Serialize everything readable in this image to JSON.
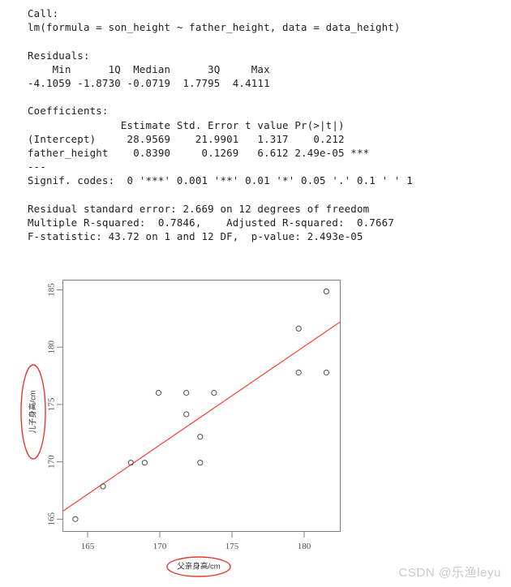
{
  "console": {
    "lines": [
      "Call:",
      "lm(formula = son_height ~ father_height, data = data_height)",
      "",
      "Residuals:",
      "    Min      1Q  Median      3Q     Max ",
      "-4.1059 -1.8730 -0.0719  1.7795  4.4111 ",
      "",
      "Coefficients:",
      "               Estimate Std. Error t value Pr(>|t|)    ",
      "(Intercept)     28.9569    21.9901   1.317    0.212    ",
      "father_height    0.8390     0.1269   6.612 2.49e-05 ***",
      "---",
      "Signif. codes:  0 '***' 0.001 '**' 0.01 '*' 0.05 '.' 0.1 ' ' 1",
      "",
      "Residual standard error: 2.669 on 12 degrees of freedom",
      "Multiple R-squared:  0.7846,    Adjusted R-squared:  0.7667 ",
      "F-statistic: 43.72 on 1 and 12 DF,  p-value: 2.493e-05"
    ]
  },
  "chart_data": {
    "type": "scatter",
    "title": "",
    "xlabel": "父亲身高/cm",
    "ylabel": "儿子身高/cm",
    "xlim": [
      163.0,
      183.0
    ],
    "ylim": [
      163.9,
      186.2
    ],
    "xticks": [
      165,
      170,
      175,
      180
    ],
    "yticks": [
      165,
      170,
      175,
      180,
      185
    ],
    "grid": false,
    "legend": null,
    "point_marker": "open-circle",
    "point_color": "#4d4d4d",
    "line_color": "#ff3b30",
    "axis_color": "#808080",
    "highlight_color": "#e8372e",
    "x": [
      163.9,
      165.9,
      167.9,
      168.9,
      169.9,
      171.9,
      171.9,
      172.9,
      172.9,
      173.9,
      180.0,
      180.0,
      182.0,
      182.0
    ],
    "y": [
      165.0,
      167.9,
      170.0,
      170.0,
      176.2,
      176.2,
      174.3,
      172.3,
      170.0,
      176.2,
      181.9,
      178.0,
      185.2,
      178.0
    ],
    "fit_line": {
      "label": "lm fit",
      "intercept": 28.9569,
      "slope": 0.839,
      "x_start": 163.0,
      "x_end": 183.0,
      "y_start": 165.7,
      "y_end": 182.5
    },
    "annotations": [
      {
        "name": "ylabel-ellipse",
        "shape": "ellipse",
        "color": "#e8372e"
      },
      {
        "name": "xlabel-ellipse",
        "shape": "ellipse",
        "color": "#e8372e"
      }
    ]
  },
  "watermark": {
    "text": "CSDN @乐渔leyu"
  }
}
